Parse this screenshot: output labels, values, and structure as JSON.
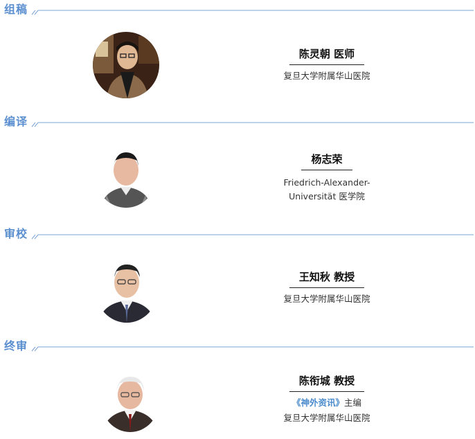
{
  "sections": [
    {
      "label": "组稿",
      "name": "陈灵朝 医师",
      "affiliation_lines": [
        "复旦大学附属华山医院"
      ]
    },
    {
      "label": "编译",
      "name": "杨志荣",
      "affiliation_lines": [
        "Friedrich-Alexander-",
        "Universität 医学院"
      ]
    },
    {
      "label": "审校",
      "name": "王知秋 教授",
      "affiliation_lines": [
        "复旦大学附属华山医院"
      ]
    },
    {
      "label": "终审",
      "name": "陈衔城 教授",
      "role_journal": "《神外资讯》",
      "role_title": "主编",
      "affiliation_lines": [
        "复旦大学附属华山医院"
      ]
    }
  ],
  "colors": {
    "accent": "#5b8fd0",
    "journal": "#4b8ccd",
    "name_rule": "#222222"
  },
  "icons": {
    "divider": "double-slash-divider",
    "portrait": "person-portrait"
  }
}
